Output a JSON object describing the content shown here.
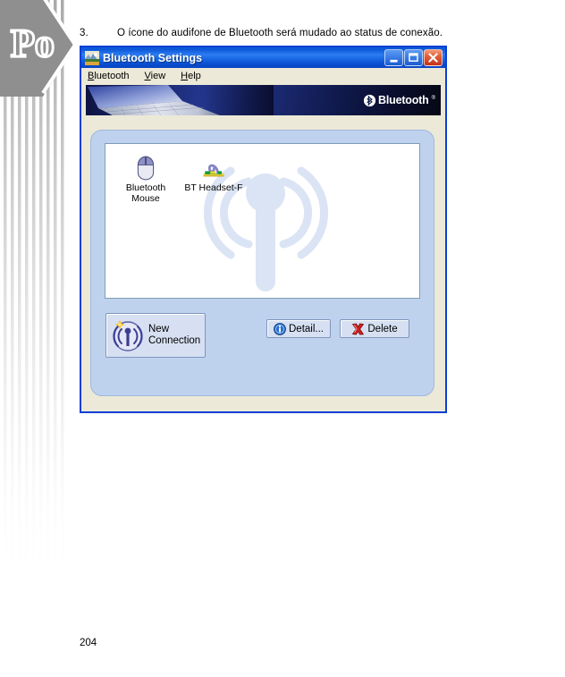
{
  "document": {
    "step_number": "3.",
    "caption": "O ícone do audifone de Bluetooth será mudado ao status de conexão.",
    "page_number": "204",
    "watermark_text": "Po"
  },
  "window": {
    "title": "Bluetooth Settings",
    "title_icon": "bluetooth-settings-icon",
    "controls": [
      {
        "name": "minimize-button",
        "label": "_",
        "icon": "minimize-icon"
      },
      {
        "name": "maximize-button",
        "label": "□",
        "icon": "maximize-icon"
      },
      {
        "name": "close-button",
        "label": "✕",
        "icon": "close-icon"
      }
    ]
  },
  "menubar": {
    "items": [
      {
        "label": "Bluetooth",
        "accel": "B",
        "rest": "luetooth"
      },
      {
        "label": "View",
        "accel": "V",
        "rest": "iew"
      },
      {
        "label": "Help",
        "accel": "H",
        "rest": "elp"
      }
    ]
  },
  "banner": {
    "logo_text": "Bluetooth",
    "logo_tm": "®",
    "logo_icon": "bluetooth-rune-icon",
    "background_image": "laptop-keyboard-photo"
  },
  "device_list": {
    "watermark_icon": "antenna-signal-watermark",
    "devices": [
      {
        "name": "Bluetooth Mouse",
        "line1": "Bluetooth",
        "line2": "Mouse",
        "icon": "bluetooth-mouse-icon"
      },
      {
        "name": "BT Headset-F",
        "line1": "BT Headset-F",
        "line2": "",
        "icon": "bluetooth-headset-icon"
      }
    ]
  },
  "buttons": {
    "new_connection": {
      "line1": "New",
      "line2": "Connection",
      "icon": "new-connection-antenna-icon"
    },
    "detail": {
      "label": "Detail...",
      "icon": "info-icon"
    },
    "delete": {
      "label": "Delete",
      "icon": "red-x-icon"
    }
  },
  "colors": {
    "titlebar_blue": "#0a55d6",
    "window_border": "#0a3fd4",
    "panel_blue": "#bed2ee",
    "button_face": "#d6e0f2",
    "dialog_face": "#ece9d8",
    "banner_dark": "#101a4e"
  }
}
